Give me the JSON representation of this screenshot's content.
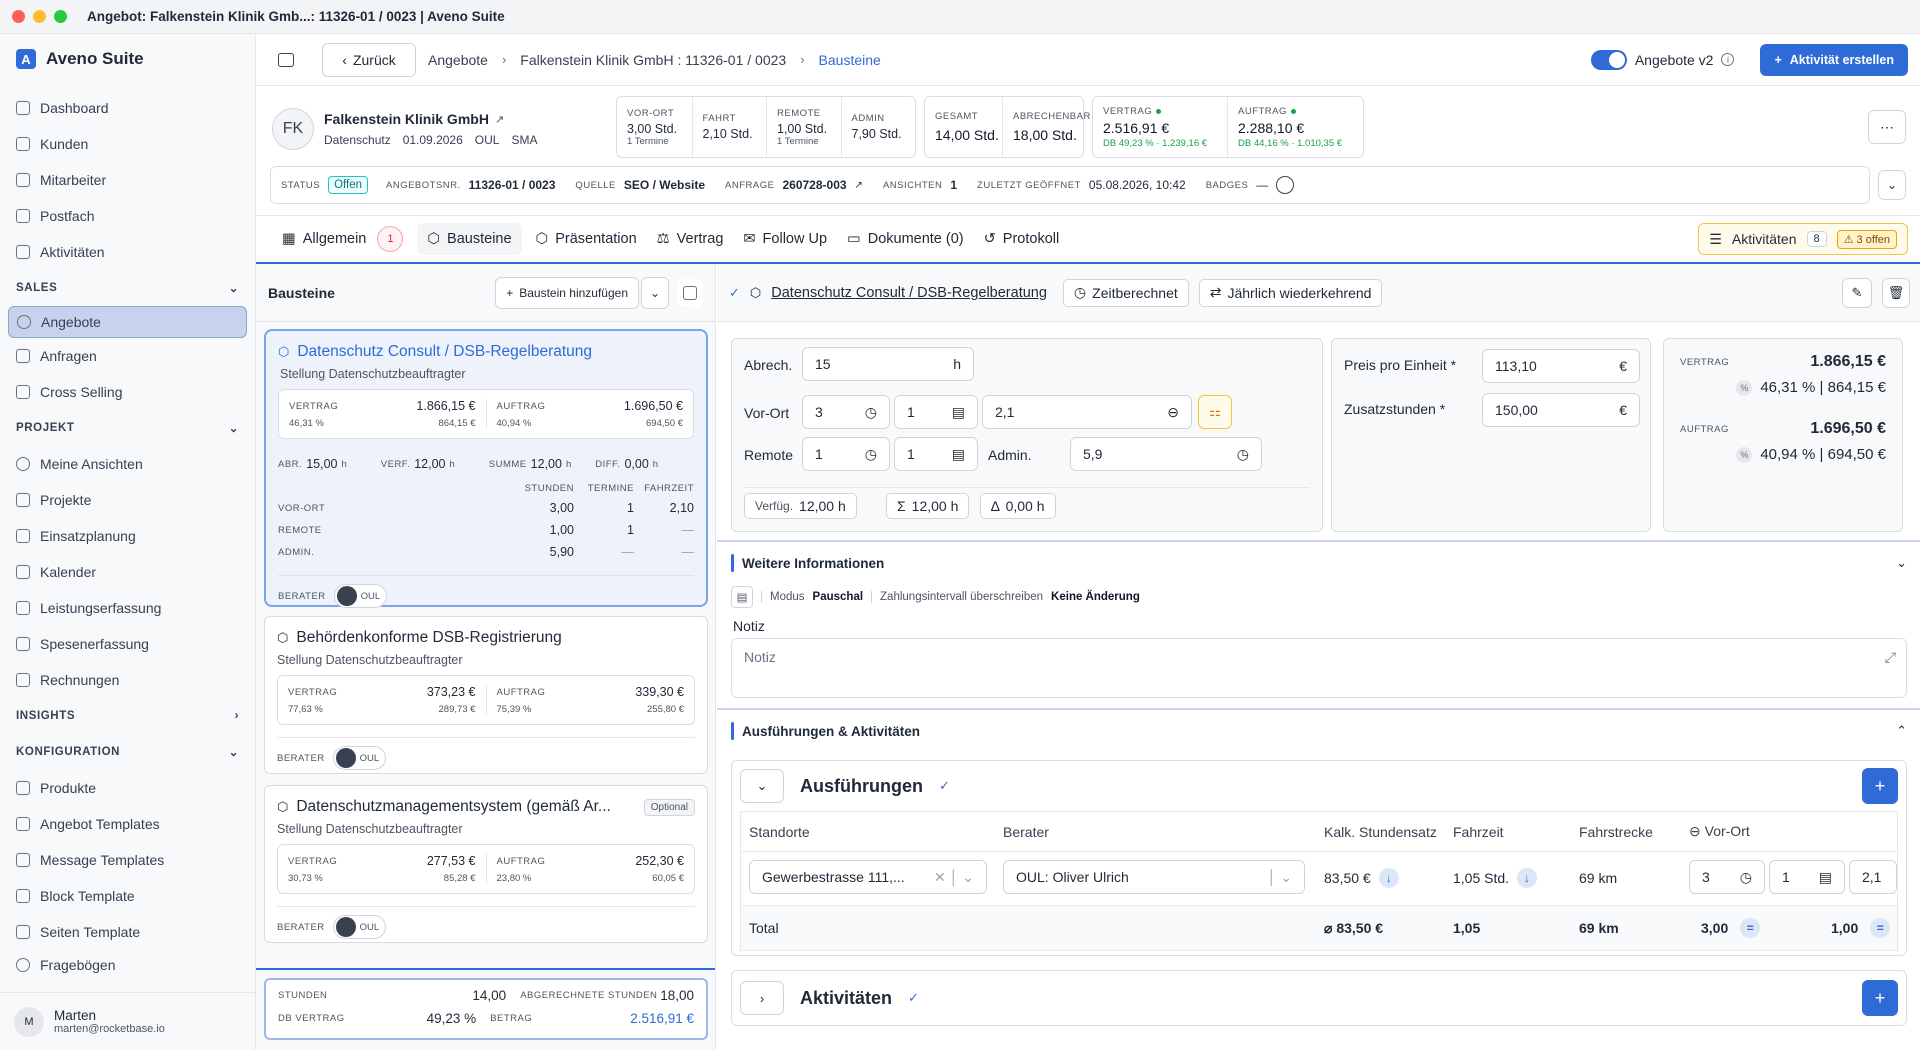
{
  "window": {
    "title": "Angebot: Falkenstein Klinik Gmb...: 11326-01 / 0023 | Aveno Suite"
  },
  "sidebar": {
    "brand": "Aveno Suite",
    "logo_letter": "A",
    "items_top": [
      "Dashboard",
      "Kunden",
      "Mitarbeiter",
      "Postfach",
      "Aktivitäten"
    ],
    "sec_sales": "SALES",
    "items_sales": [
      "Angebote",
      "Anfragen",
      "Cross Selling"
    ],
    "sec_projekt": "PROJEKT",
    "items_projekt": [
      "Meine Ansichten",
      "Projekte",
      "Einsatzplanung",
      "Kalender",
      "Leistungserfassung",
      "Spesenerfassung",
      "Rechnungen"
    ],
    "sec_insights": "INSIGHTS",
    "sec_konfig": "KONFIGURATION",
    "items_konfig": [
      "Produkte",
      "Angebot Templates",
      "Message Templates",
      "Block Template",
      "Seiten Template",
      "Fragebögen"
    ],
    "user": {
      "initial": "M",
      "name": "Marten",
      "email": "marten@rocketbase.io"
    }
  },
  "header": {
    "back": "Zurück",
    "crumb1": "Angebote",
    "crumb2": "Falkenstein Klinik GmbH : 11326-01 / 0023",
    "crumb3": "Bausteine",
    "toggle_label": "Angebote v2",
    "cta": "Aktivität erstellen"
  },
  "customer": {
    "initials": "FK",
    "name": "Falkenstein Klinik GmbH",
    "tag": "Datenschutz",
    "date": "01.09.2026",
    "code1": "OUL",
    "code2": "SMA"
  },
  "stats": {
    "vorort": {
      "label": "VOR-ORT",
      "value": "3,00 Std.",
      "sub": "1 Termine"
    },
    "fahrt": {
      "label": "FAHRT",
      "value": "2,10 Std."
    },
    "remote": {
      "label": "REMOTE",
      "value": "1,00 Std.",
      "sub": "1 Termine"
    },
    "admin": {
      "label": "ADMIN",
      "value": "7,90 Std."
    },
    "gesamt": {
      "label": "GESAMT",
      "value": "14,00 Std."
    },
    "abrechenbar": {
      "label": "ABRECHENBAR",
      "value": "18,00 Std."
    },
    "vertrag": {
      "label": "VERTRAG",
      "value": "2.516,91 €",
      "sub": "DB 49,23 % · 1.239,16 €"
    },
    "auftrag": {
      "label": "AUFTRAG",
      "value": "2.288,10 €",
      "sub": "DB 44,16 % · 1.010,35 €"
    }
  },
  "meta": {
    "status_l": "STATUS",
    "status": "Offen",
    "nr_l": "ANGEBOTSNR.",
    "nr": "11326-01 / 0023",
    "quelle_l": "QUELLE",
    "quelle": "SEO / Website",
    "anfrage_l": "ANFRAGE",
    "anfrage": "260728-003",
    "ansichten_l": "ANSICHTEN",
    "ansichten": "1",
    "zuletzt_l": "ZULETZT GEÖFFNET",
    "zuletzt": "05.08.2026, 10:42",
    "badges_l": "BADGES",
    "badges": "—"
  },
  "tabs": {
    "allgemein": "Allgemein",
    "allgemein_count": "1",
    "bausteine": "Bausteine",
    "praesentation": "Präsentation",
    "vertrag": "Vertrag",
    "followup": "Follow Up",
    "dokumente": "Dokumente (0)",
    "protokoll": "Protokoll",
    "aktivitaeten": "Aktivitäten",
    "akt_count": "8",
    "akt_open": "3 offen"
  },
  "left": {
    "title": "Bausteine",
    "add": "Baustein hinzufügen",
    "b1": {
      "title": "Datenschutz Consult / DSB-Regelberatung",
      "sub": "Stellung Datenschutzbeauftragter",
      "v_l": "VERTRAG",
      "v": "1.866,15 €",
      "v_pct": "46,31 %",
      "v_amt": "864,15 €",
      "a_l": "AUFTRAG",
      "a": "1.696,50 €",
      "a_pct": "40,94 %",
      "a_amt": "694,50 €",
      "abr_l": "ABR.",
      "abr": "15,00",
      "verf_l": "VERF.",
      "verf": "12,00",
      "summe_l": "SUMME",
      "summe": "12,00",
      "diff_l": "DIFF.",
      "diff": "0,00",
      "unit_h": "h",
      "h_stunden": "STUNDEN",
      "h_termine": "TERMINE",
      "h_fahrzeit": "FAHRZEIT",
      "r1": "VOR-ORT",
      "r1s": "3,00",
      "r1t": "1",
      "r1f": "2,10",
      "r2": "REMOTE",
      "r2s": "1,00",
      "r2t": "1",
      "r2f": "—",
      "r3": "ADMIN.",
      "r3s": "5,90",
      "r3t": "—",
      "r3f": "—",
      "berater_l": "BERATER",
      "berater": "OUL"
    },
    "b2": {
      "title": "Behördenkonforme DSB-Registrierung",
      "sub": "Stellung Datenschutzbeauftragter",
      "v": "373,23 €",
      "v_pct": "77,63 %",
      "v_amt": "289,73 €",
      "a": "339,30 €",
      "a_pct": "75,39 %",
      "a_amt": "255,80 €"
    },
    "b3": {
      "title": "Datenschutzmanagementsystem (gemäß Ar...",
      "optional": "Optional",
      "sub": "Stellung Datenschutzbeauftragter",
      "v": "277,53 €",
      "v_pct": "30,73 %",
      "v_amt": "85,28 €",
      "a": "252,30 €",
      "a_pct": "23,80 %",
      "a_amt": "60,05 €"
    },
    "sum": {
      "stunden_l": "STUNDEN",
      "stunden": "14,00",
      "abg_l": "ABGERECHNETE STUNDEN",
      "abg": "18,00",
      "db_l": "DB VERTRAG",
      "db": "49,23 %",
      "betrag_l": "BETRAG",
      "betrag": "2.516,91 €"
    }
  },
  "right": {
    "title": "Datenschutz Consult / DSB-Regelberatung",
    "chip1": "Zeitberechnet",
    "chip2": "Jährlich wiederkehrend",
    "abrech_l": "Abrech.",
    "abrech": "15",
    "vorort_l": "Vor-Ort",
    "vorort1": "3",
    "vorort2": "1",
    "vorort3": "2,1",
    "remote_l": "Remote",
    "remote1": "1",
    "remote2": "1",
    "admin_l": "Admin.",
    "admin": "5,9",
    "verfueg": "Verfüg.",
    "verfueg_v": "12,00 h",
    "sigma": "12,00 h",
    "delta": "0,00 h",
    "ppe_l": "Preis pro Einheit *",
    "ppe": "113,10",
    "zus_l": "Zusatzstunden *",
    "zus": "150,00",
    "eur": "€",
    "vertrag_l": "VERTRAG",
    "vertrag": "1.866,15 €",
    "vertrag_sub": "46,31 % | 864,15 €",
    "auftrag_l": "AUFTRAG",
    "auftrag": "1.696,50 €",
    "auftrag_sub": "40,94 % | 694,50 €",
    "weitere": "Weitere Informationen",
    "modus_l": "Modus",
    "modus": "Pauschal",
    "zahl_l": "Zahlungsintervall überschreiben",
    "zahl": "Keine Änderung",
    "notiz_l": "Notiz",
    "notiz_ph": "Notiz",
    "ausf_sec": "Ausführungen & Aktivitäten",
    "ausf": "Ausführungen",
    "th": [
      "Standorte",
      "Berater",
      "Kalk. Stundensatz",
      "Fahrzeit",
      "Fahrstrecke",
      "Vor-Ort"
    ],
    "row": {
      "standort": "Gewerbestrasse 111,...",
      "berater": "OUL: Oliver Ulrich",
      "satz": "83,50 €",
      "fahrzeit": "1,05 Std.",
      "strecke": "69 km",
      "v1": "3",
      "v2": "1",
      "v3": "2,1"
    },
    "total": {
      "label": "Total",
      "satz": "83,50 €",
      "fahrzeit": "1,05",
      "strecke": "69 km",
      "v1": "3,00",
      "v2": "1,00"
    },
    "akt": "Aktivitäten"
  }
}
